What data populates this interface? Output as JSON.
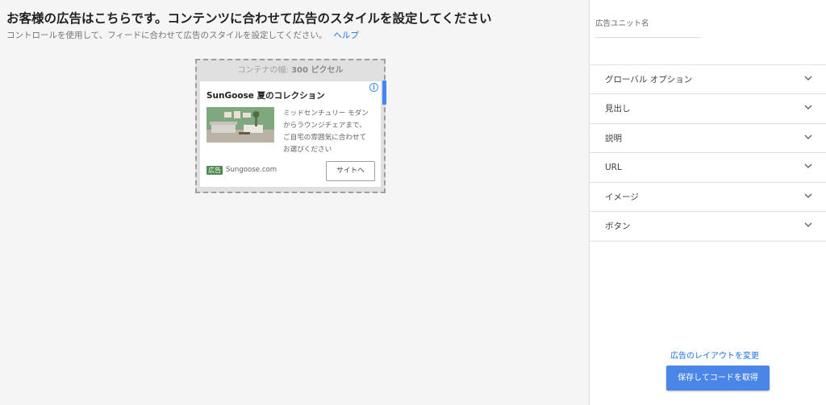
{
  "main": {
    "title": "お客様の広告はこちらです。コンテンツに合わせて広告のスタイルを設定してください",
    "subtitle": "コントロールを使用して、フィードに合わせて広告のスタイルを設定してください。",
    "help_link": "ヘルプ"
  },
  "preview": {
    "container_label_prefix": "コンテナの幅:",
    "container_width": "300 ピクセル",
    "ad": {
      "title": "SunGoose 夏のコレクション",
      "description_lines": [
        "ミッドセンチュリー モダン",
        "からラウンジチェアまで、",
        "ご自宅の雰囲気に合わせて",
        "お選びください"
      ],
      "badge": "広告",
      "domain": "Sungoose.com",
      "cta": "サイトへ",
      "info_icon": "i"
    }
  },
  "panel": {
    "unit_name_label": "広告ユニット名",
    "unit_name_value": "",
    "sections": [
      {
        "label": "グローバル オプション",
        "icon": "chevron-down-icon"
      },
      {
        "label": "見出し",
        "icon": "chevron-down-icon"
      },
      {
        "label": "説明",
        "icon": "chevron-down-icon"
      },
      {
        "label": "URL",
        "icon": "chevron-down-icon"
      },
      {
        "label": "イメージ",
        "icon": "chevron-down-icon"
      },
      {
        "label": "ボタン",
        "icon": "chevron-down-icon"
      }
    ],
    "change_layout_link": "広告のレイアウトを変更",
    "save_button": "保存してコードを取得"
  },
  "colors": {
    "accent": "#1a73e8",
    "button": "#4a86e8",
    "ad_badge": "#4f8a4f"
  }
}
